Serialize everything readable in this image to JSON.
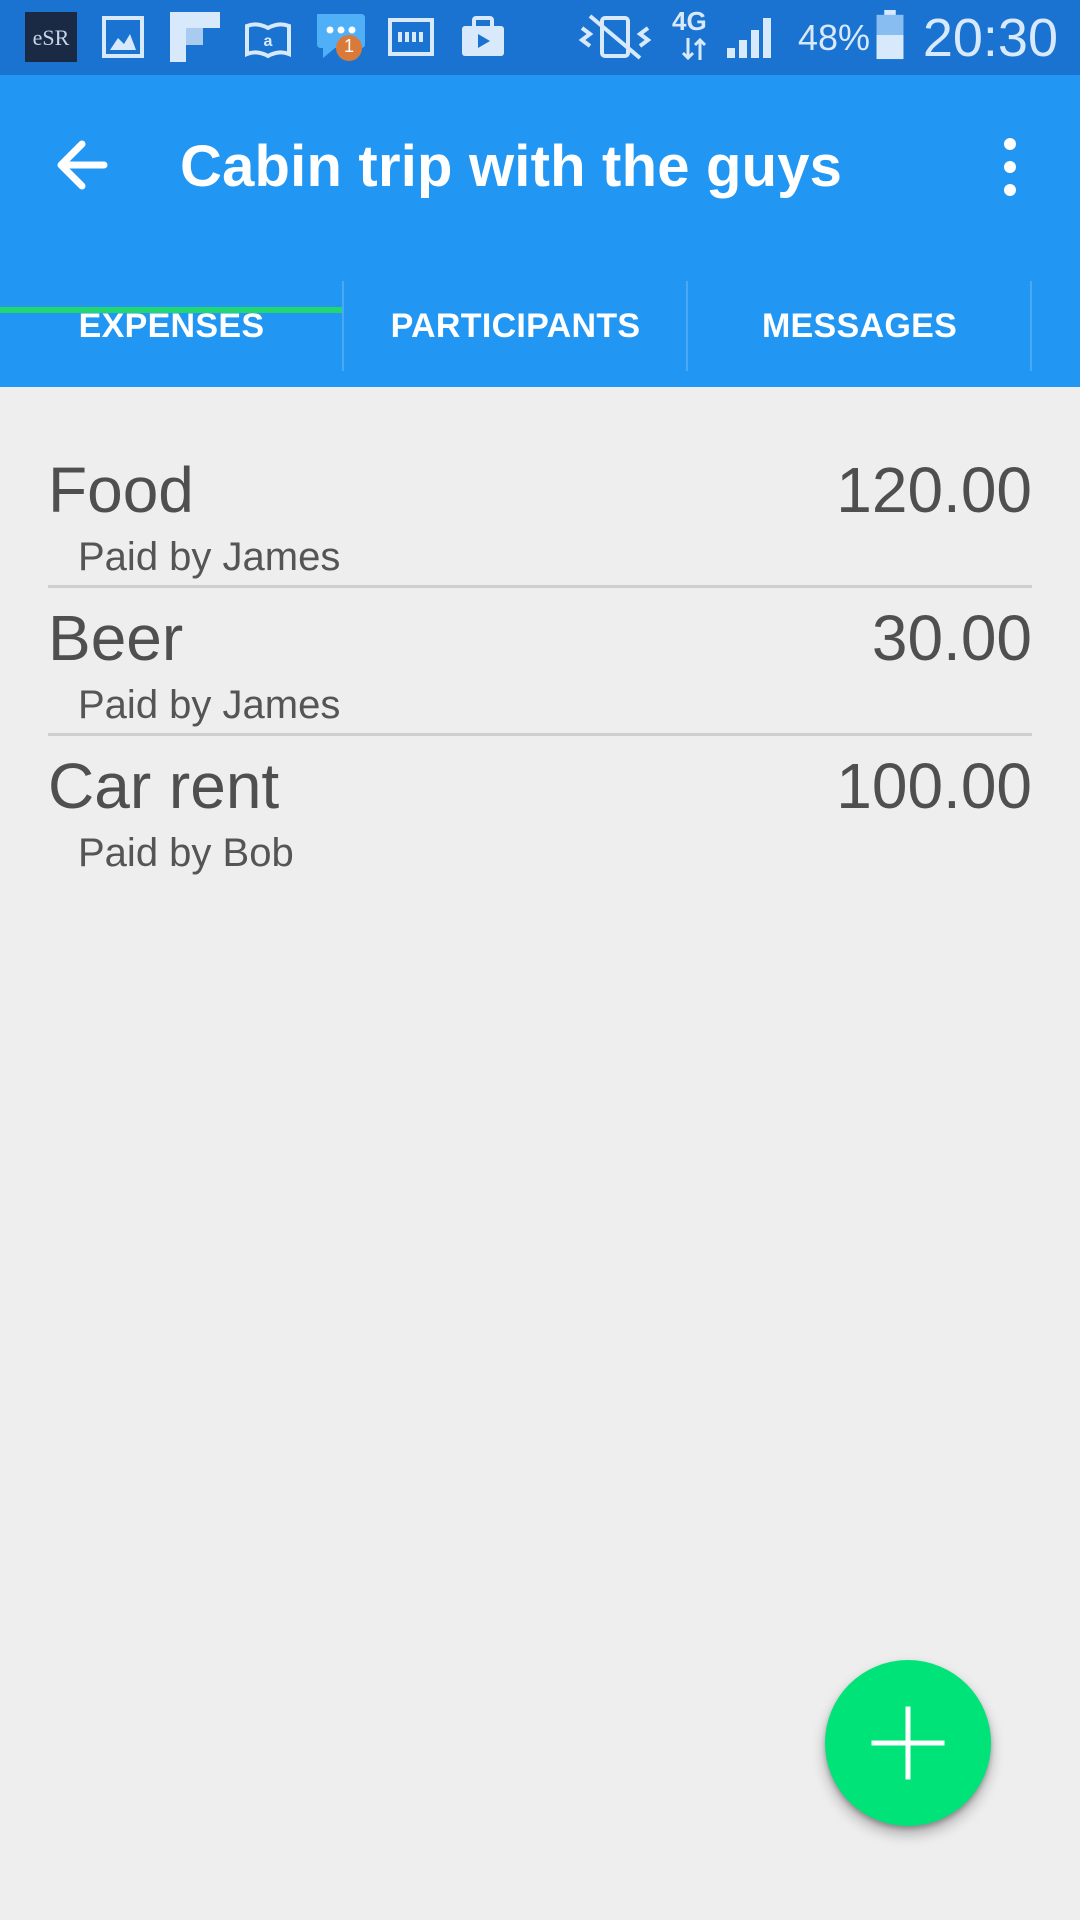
{
  "status_bar": {
    "network": "4G",
    "battery": "48%",
    "time": "20:30",
    "notification_count": "1",
    "notification_icons": [
      "app-logo-icon",
      "gallery-icon",
      "flipboard-icon",
      "amazon-kindle-icon",
      "messages-icon",
      "media-icon",
      "briefcase-icon"
    ],
    "colors": {
      "background": "#1a73d1"
    }
  },
  "app_bar": {
    "title": "Cabin trip with the guys",
    "back_icon": "arrow-back-icon",
    "overflow_icon": "more-vert-icon",
    "colors": {
      "background": "#2196f3",
      "text": "#ffffff"
    }
  },
  "tabs": {
    "items": [
      {
        "label": "EXPENSES",
        "selected": true
      },
      {
        "label": "PARTICIPANTS",
        "selected": false
      },
      {
        "label": "MESSAGES",
        "selected": false
      }
    ],
    "colors": {
      "indicator": "#22d672"
    }
  },
  "expenses": [
    {
      "name": "Food",
      "amount": "120.00",
      "payer": "Paid by James"
    },
    {
      "name": "Beer",
      "amount": "30.00",
      "payer": "Paid by James"
    },
    {
      "name": "Car rent",
      "amount": "100.00",
      "payer": "Paid by Bob"
    }
  ],
  "fab": {
    "icon": "plus-icon",
    "colors": {
      "background": "#00e378"
    }
  }
}
